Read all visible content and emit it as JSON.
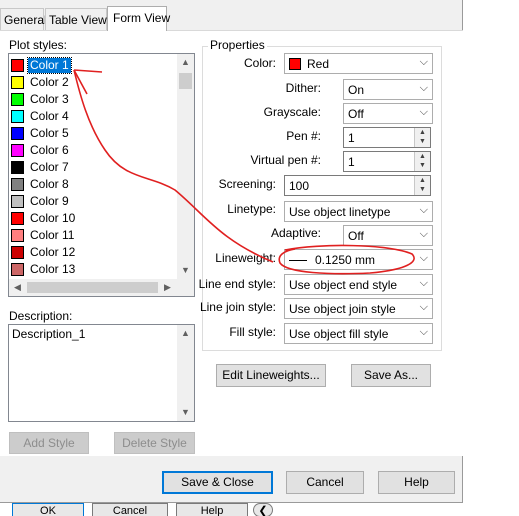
{
  "tabs": [
    {
      "label": "General"
    },
    {
      "label": "Table View"
    },
    {
      "label": "Form View"
    }
  ],
  "plot_styles": {
    "label": "Plot styles:",
    "items": [
      {
        "label": "Color 1",
        "color": "#ff0000",
        "selected": true
      },
      {
        "label": "Color 2",
        "color": "#ffff00"
      },
      {
        "label": "Color 3",
        "color": "#00ff00"
      },
      {
        "label": "Color 4",
        "color": "#00ffff"
      },
      {
        "label": "Color 5",
        "color": "#0000ff"
      },
      {
        "label": "Color 6",
        "color": "#ff00ff"
      },
      {
        "label": "Color 7",
        "color": "#000000"
      },
      {
        "label": "Color 8",
        "color": "#808080"
      },
      {
        "label": "Color 9",
        "color": "#c0c0c0"
      },
      {
        "label": "Color 10",
        "color": "#ff0000"
      },
      {
        "label": "Color 11",
        "color": "#ff7f7f"
      },
      {
        "label": "Color 12",
        "color": "#cc0000"
      },
      {
        "label": "Color 13",
        "color": "#cc6666"
      }
    ]
  },
  "description": {
    "label": "Description:",
    "value": "Description_1"
  },
  "left_buttons": {
    "add_style": "Add Style",
    "delete_style": "Delete Style"
  },
  "properties": {
    "title": "Properties",
    "color_label": "Color:",
    "color_value": "Red",
    "color_swatch": "#ff0000",
    "dither_label": "Dither:",
    "dither_value": "On",
    "grayscale_label": "Grayscale:",
    "grayscale_value": "Off",
    "pen_label": "Pen #:",
    "pen_value": "1",
    "virtual_pen_label": "Virtual pen #:",
    "virtual_pen_value": "1",
    "screening_label": "Screening:",
    "screening_value": "100",
    "linetype_label": "Linetype:",
    "linetype_value": "Use object linetype",
    "adaptive_label": "Adaptive:",
    "adaptive_value": "Off",
    "lineweight_label": "Lineweight:",
    "lineweight_value": "0.1250 mm",
    "line_end_label": "Line end style:",
    "line_end_value": "Use object end style",
    "line_join_label": "Line join style:",
    "line_join_value": "Use object join style",
    "fill_label": "Fill style:",
    "fill_value": "Use object fill style"
  },
  "mid_buttons": {
    "edit_lineweights": "Edit Lineweights...",
    "save_as": "Save As..."
  },
  "footer_buttons": {
    "save_close": "Save & Close",
    "cancel": "Cancel",
    "help": "Help"
  },
  "background_dialog": {
    "ok": "OK",
    "cancel": "Cancel",
    "help": "Help"
  },
  "annotation_color": "#e02020",
  "selection_color": "#0078d7"
}
